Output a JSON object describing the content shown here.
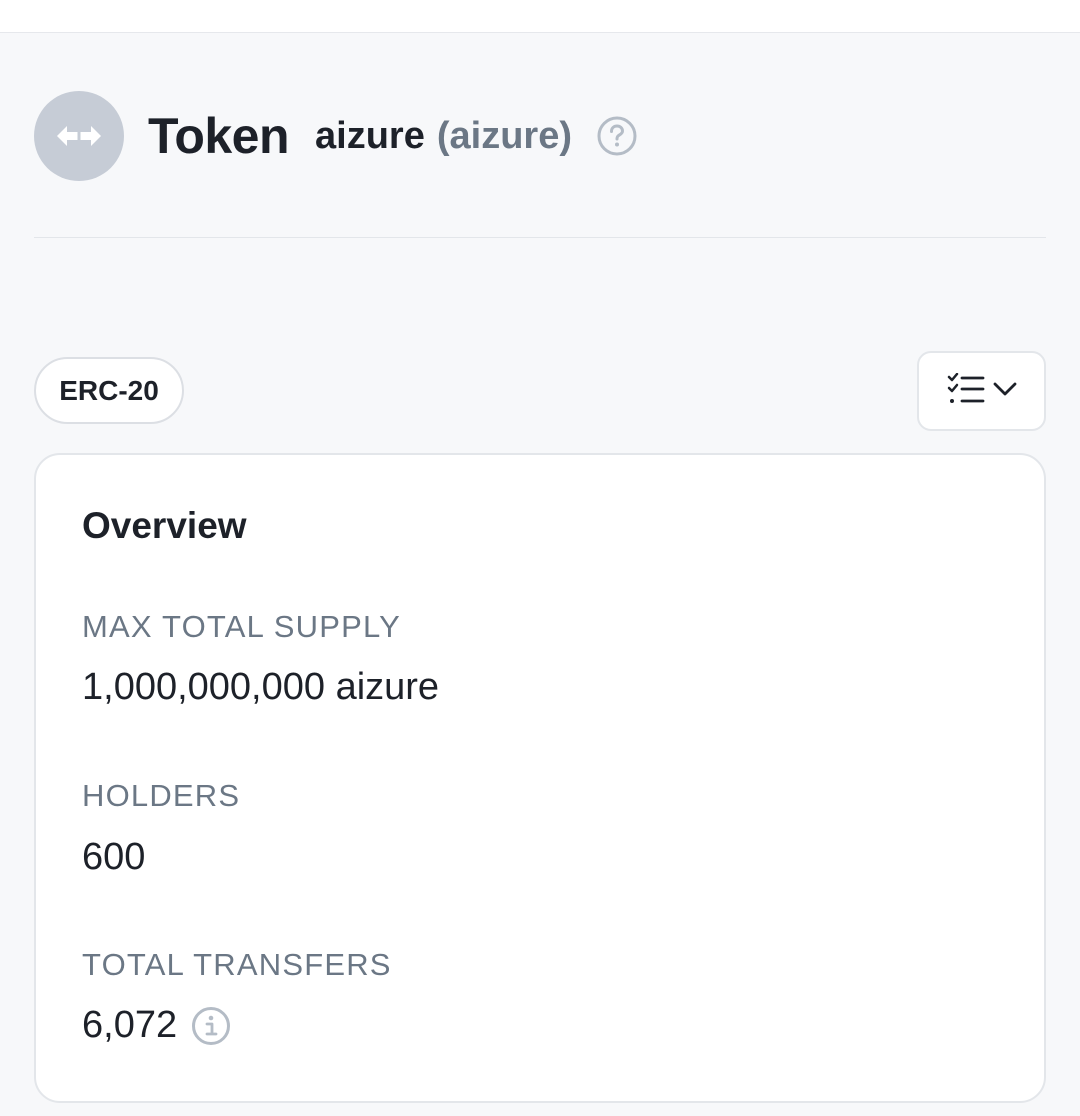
{
  "header": {
    "title": "Token",
    "token_name": "aizure",
    "token_symbol": "(aizure)",
    "icon": "token-swap-icon",
    "help_icon": "question-circle-icon"
  },
  "badge": {
    "label": "ERC-20"
  },
  "toolbar": {
    "dropdown_icon": "checklist-icon",
    "chevron_icon": "chevron-down-icon"
  },
  "overview": {
    "title": "Overview",
    "stats": [
      {
        "label": "MAX TOTAL SUPPLY",
        "value": "1,000,000,000 aizure"
      },
      {
        "label": "HOLDERS",
        "value": "600"
      },
      {
        "label": "TOTAL TRANSFERS",
        "value": "6,072",
        "icon": "info-icon"
      }
    ]
  },
  "colors": {
    "page_bg": "#f7f8fa",
    "token_icon_bg": "#c6ccd6",
    "muted_text": "#6b7785",
    "primary_text": "#1d2129",
    "border": "#e3e6ea"
  }
}
